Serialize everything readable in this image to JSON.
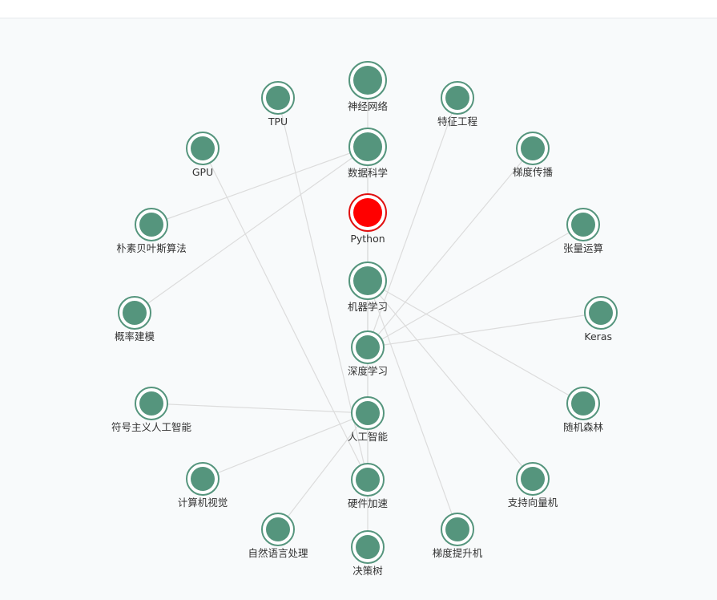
{
  "colors": {
    "node_fill": "#55957d",
    "node_ring": "#55957d",
    "highlight_fill": "#ff0000",
    "highlight_ring": "#e01010",
    "edge": "#dcdcdc",
    "label": "#333333",
    "background": "#f8fafb"
  },
  "graph": {
    "nodes": [
      {
        "id": "shenjing",
        "label": "神经网络",
        "size": "large"
      },
      {
        "id": "tpu",
        "label": "TPU",
        "size": "medium"
      },
      {
        "id": "tezheng",
        "label": "特征工程",
        "size": "medium"
      },
      {
        "id": "gpu",
        "label": "GPU",
        "size": "medium"
      },
      {
        "id": "shuju",
        "label": "数据科学",
        "size": "large"
      },
      {
        "id": "tidu",
        "label": "梯度传播",
        "size": "medium"
      },
      {
        "id": "pusu",
        "label": "朴素贝叶斯算法",
        "size": "medium"
      },
      {
        "id": "python",
        "label": "Python",
        "size": "large",
        "highlighted": true
      },
      {
        "id": "zhangliang",
        "label": "张量运算",
        "size": "medium"
      },
      {
        "id": "jiqi",
        "label": "机器学习",
        "size": "large"
      },
      {
        "id": "gailv",
        "label": "概率建模",
        "size": "medium"
      },
      {
        "id": "keras",
        "label": "Keras",
        "size": "medium"
      },
      {
        "id": "shendu",
        "label": "深度学习",
        "size": "medium"
      },
      {
        "id": "fuhao",
        "label": "符号主义人工智能",
        "size": "medium"
      },
      {
        "id": "rengong",
        "label": "人工智能",
        "size": "medium"
      },
      {
        "id": "suiji",
        "label": "随机森林",
        "size": "medium"
      },
      {
        "id": "jisuanji",
        "label": "计算机视觉",
        "size": "medium"
      },
      {
        "id": "yingjian",
        "label": "硬件加速",
        "size": "medium"
      },
      {
        "id": "zhichi",
        "label": "支持向量机",
        "size": "medium"
      },
      {
        "id": "ziran",
        "label": "自然语言处理",
        "size": "medium"
      },
      {
        "id": "tiduti",
        "label": "梯度提升机",
        "size": "medium"
      },
      {
        "id": "juece",
        "label": "决策树",
        "size": "medium"
      }
    ],
    "edges": [
      [
        "shuju",
        "pusu"
      ],
      [
        "shuju",
        "gailv"
      ],
      [
        "shuju",
        "jiqi"
      ],
      [
        "python",
        "shendu"
      ],
      [
        "jiqi",
        "suiji"
      ],
      [
        "jiqi",
        "zhichi"
      ],
      [
        "jiqi",
        "tiduti"
      ],
      [
        "jiqi",
        "juece"
      ],
      [
        "tpu",
        "yingjian"
      ],
      [
        "gpu",
        "yingjian"
      ],
      [
        "tezheng",
        "shendu"
      ],
      [
        "tidu",
        "shendu"
      ],
      [
        "zhangliang",
        "shendu"
      ],
      [
        "keras",
        "shendu"
      ],
      [
        "fuhao",
        "rengong"
      ],
      [
        "jisuanji",
        "rengong"
      ],
      [
        "ziran",
        "rengong"
      ],
      [
        "rengong",
        "yingjian"
      ],
      [
        "shenjing",
        "shendu"
      ],
      [
        "shendu",
        "rengong"
      ]
    ]
  }
}
